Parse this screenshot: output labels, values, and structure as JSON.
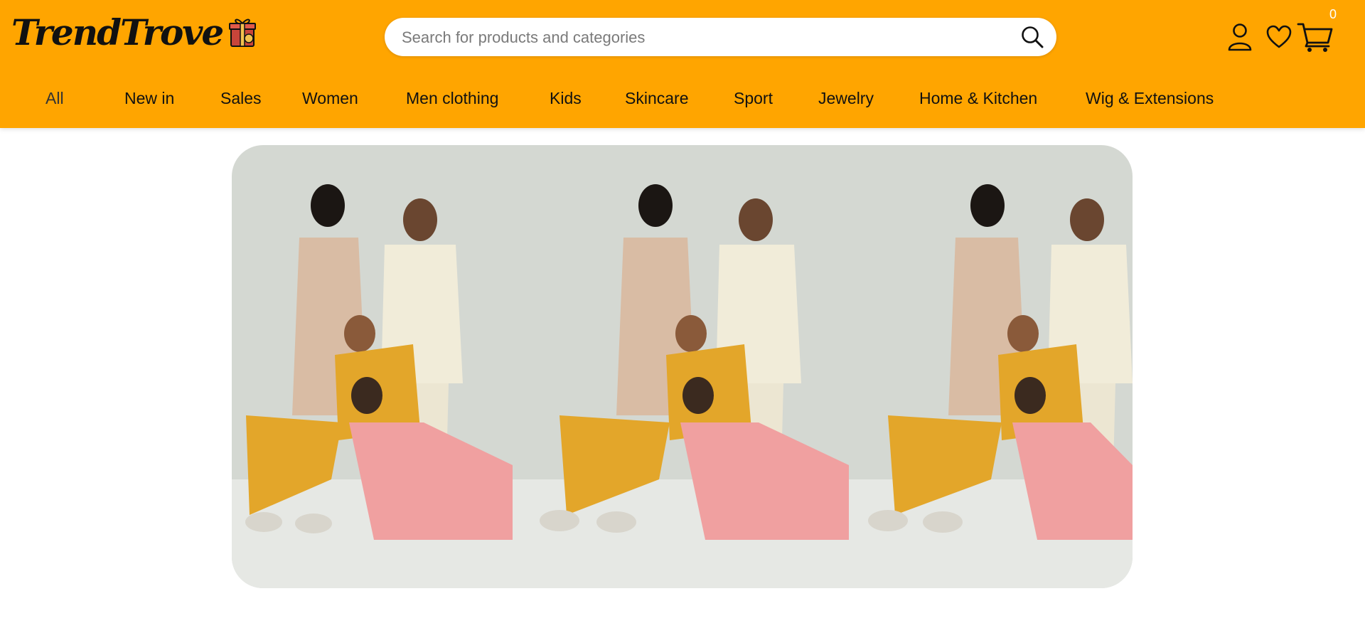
{
  "brand": {
    "name": "TrendTrove"
  },
  "search": {
    "placeholder": "Search for products and categories"
  },
  "header": {
    "cart_count": "0"
  },
  "nav": {
    "items": [
      {
        "label": "All",
        "key": "all",
        "active": true
      },
      {
        "label": "New in",
        "key": "new-in"
      },
      {
        "label": "Sales",
        "key": "sales"
      },
      {
        "label": "Women",
        "key": "women"
      },
      {
        "label": "Men clothing",
        "key": "men-clothing"
      },
      {
        "label": "Kids",
        "key": "kids"
      },
      {
        "label": "Skincare",
        "key": "skincare"
      },
      {
        "label": "Sport",
        "key": "sport"
      },
      {
        "label": "Jewelry",
        "key": "jewelry"
      },
      {
        "label": "Home & Kitchen",
        "key": "home-kitchen"
      },
      {
        "label": "Wig & Extensions",
        "key": "wig-extensions"
      }
    ]
  },
  "icons": {
    "gift": "gift-icon",
    "search": "search-icon",
    "account": "user-icon",
    "wishlist": "heart-icon",
    "cart": "cart-icon"
  },
  "colors": {
    "header_bg": "#FFA500",
    "page_bg": "#FFFFFF",
    "text": "#111111"
  }
}
